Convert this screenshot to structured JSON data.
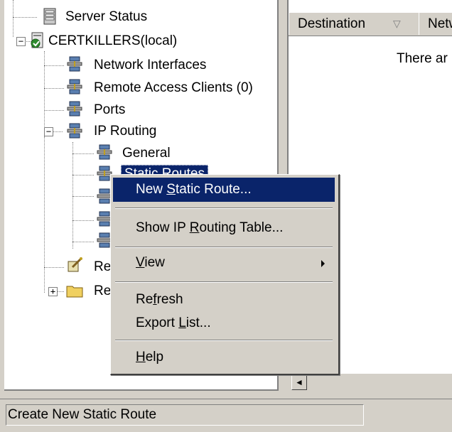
{
  "tree": {
    "items": [
      {
        "label": "Server Status",
        "icon": "server-status-icon"
      },
      {
        "label": "CERTKILLERS(local)",
        "icon": "server-icon"
      },
      {
        "label": "Network Interfaces",
        "icon": "network-icon"
      },
      {
        "label": "Remote Access Clients (0)",
        "icon": "network-icon"
      },
      {
        "label": "Ports",
        "icon": "network-icon"
      },
      {
        "label": "IP Routing",
        "icon": "network-icon"
      },
      {
        "label": "General",
        "icon": "network-icon"
      },
      {
        "label": "Static Routes",
        "icon": "network-icon"
      },
      {
        "label": "Re",
        "icon": "policy-icon"
      },
      {
        "label": "Re",
        "icon": "folder-icon"
      }
    ],
    "expander_minus": "−",
    "expander_plus": "+"
  },
  "list": {
    "columns": [
      "Destination",
      "Netw"
    ],
    "sort_indicator": "▽",
    "empty_text": "There ar"
  },
  "context_menu": {
    "items": [
      {
        "pre": "New ",
        "key": "S",
        "post": "tatic Route..."
      },
      {
        "pre": "Show IP ",
        "key": "R",
        "post": "outing Table..."
      },
      {
        "pre": "",
        "key": "V",
        "post": "iew"
      },
      {
        "pre": "Re",
        "key": "f",
        "post": "resh"
      },
      {
        "pre": "Export ",
        "key": "L",
        "post": "ist..."
      },
      {
        "pre": "",
        "key": "H",
        "post": "elp"
      }
    ]
  },
  "scrollbar": {
    "left_arrow": "◄"
  },
  "status_bar": {
    "text": "Create New Static Route"
  },
  "colors": {
    "selection": "#0a246a",
    "face": "#d4d0c8"
  }
}
